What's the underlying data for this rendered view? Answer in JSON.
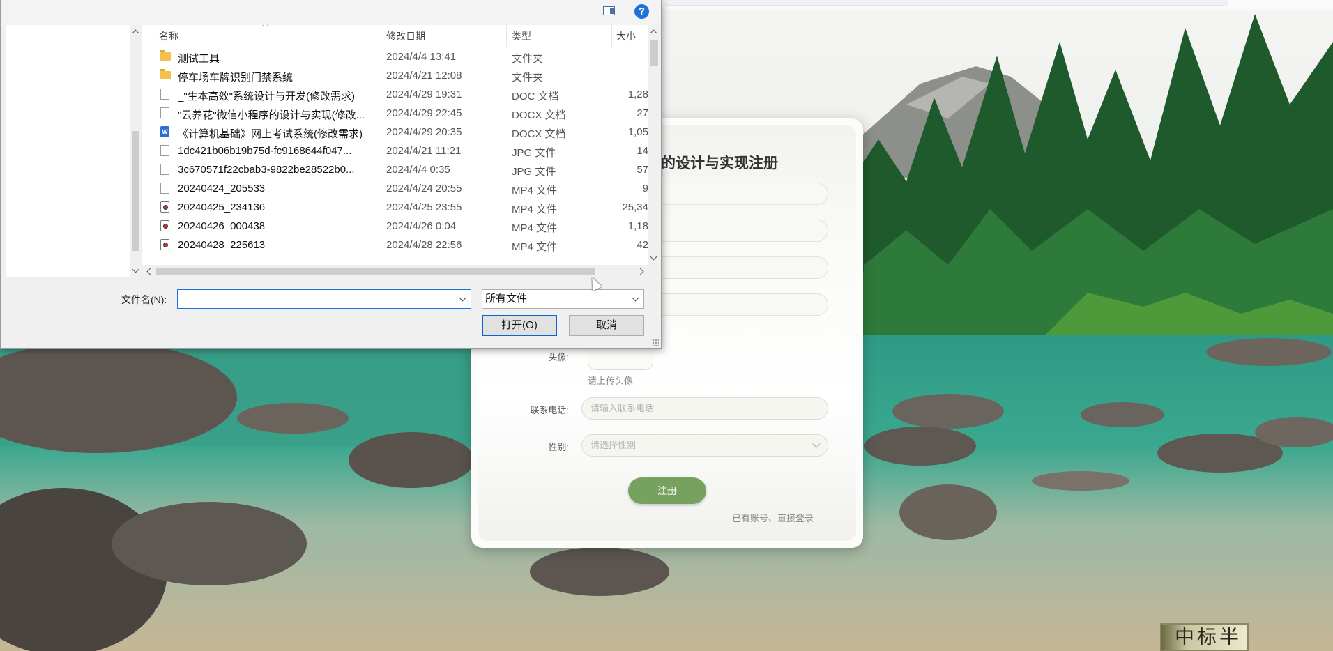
{
  "colors": {
    "accent": "#1e73d8",
    "register_button": "#77a15e",
    "folder": "#f2c14e"
  },
  "dialog": {
    "columns": {
      "name": "名称",
      "date": "修改日期",
      "type": "类型",
      "size": "大小"
    },
    "files": [
      {
        "icon": "folder-icon",
        "name": "测试工具",
        "date": "2024/4/4 13:41",
        "type": "文件夹",
        "size": ""
      },
      {
        "icon": "folder-icon",
        "name": "停车场车牌识别门禁系统",
        "date": "2024/4/21 12:08",
        "type": "文件夹",
        "size": ""
      },
      {
        "icon": "document-icon",
        "name": "_\"生本高效\"系统设计与开发(修改需求)",
        "date": "2024/4/29 19:31",
        "type": "DOC 文档",
        "size": "1,28"
      },
      {
        "icon": "document-icon",
        "name": "\"云养花\"微信小程序的设计与实现(修改...",
        "date": "2024/4/29 22:45",
        "type": "DOCX 文档",
        "size": "27"
      },
      {
        "icon": "word-icon",
        "name": "《计算机基础》网上考试系统(修改需求)",
        "date": "2024/4/29 20:35",
        "type": "DOCX 文档",
        "size": "1,05"
      },
      {
        "icon": "document-icon",
        "name": "1dc421b06b19b75d-fc9168644f047...",
        "date": "2024/4/21 11:21",
        "type": "JPG 文件",
        "size": "14"
      },
      {
        "icon": "document-icon",
        "name": "3c670571f22cbab3-9822be28522b0...",
        "date": "2024/4/4 0:35",
        "type": "JPG 文件",
        "size": "57"
      },
      {
        "icon": "document-icon",
        "name": "20240424_205533",
        "date": "2024/4/24 20:55",
        "type": "MP4 文件",
        "size": "9"
      },
      {
        "icon": "video-icon",
        "name": "20240425_234136",
        "date": "2024/4/25 23:55",
        "type": "MP4 文件",
        "size": "25,34"
      },
      {
        "icon": "video-icon",
        "name": "20240426_000438",
        "date": "2024/4/26 0:04",
        "type": "MP4 文件",
        "size": "1,18"
      },
      {
        "icon": "video-icon",
        "name": "20240428_225613",
        "date": "2024/4/28 22:56",
        "type": "MP4 文件",
        "size": "42"
      }
    ],
    "filename_label": "文件名(N):",
    "filename_value": "",
    "filter_value": "所有文件",
    "open_button": "打开(O)",
    "cancel_button": "取消",
    "help_glyph": "?"
  },
  "card": {
    "title": "的设计与实现注册",
    "avatar_label": "头像:",
    "avatar_plus": "+",
    "avatar_hint": "请上传头像",
    "phone_label": "联系电话:",
    "phone_placeholder": "请输入联系电话",
    "gender_label": "性别:",
    "gender_placeholder": "请选择性别",
    "register_button": "注册",
    "login_link": "已有账号、直接登录"
  },
  "watermark": "中标半"
}
